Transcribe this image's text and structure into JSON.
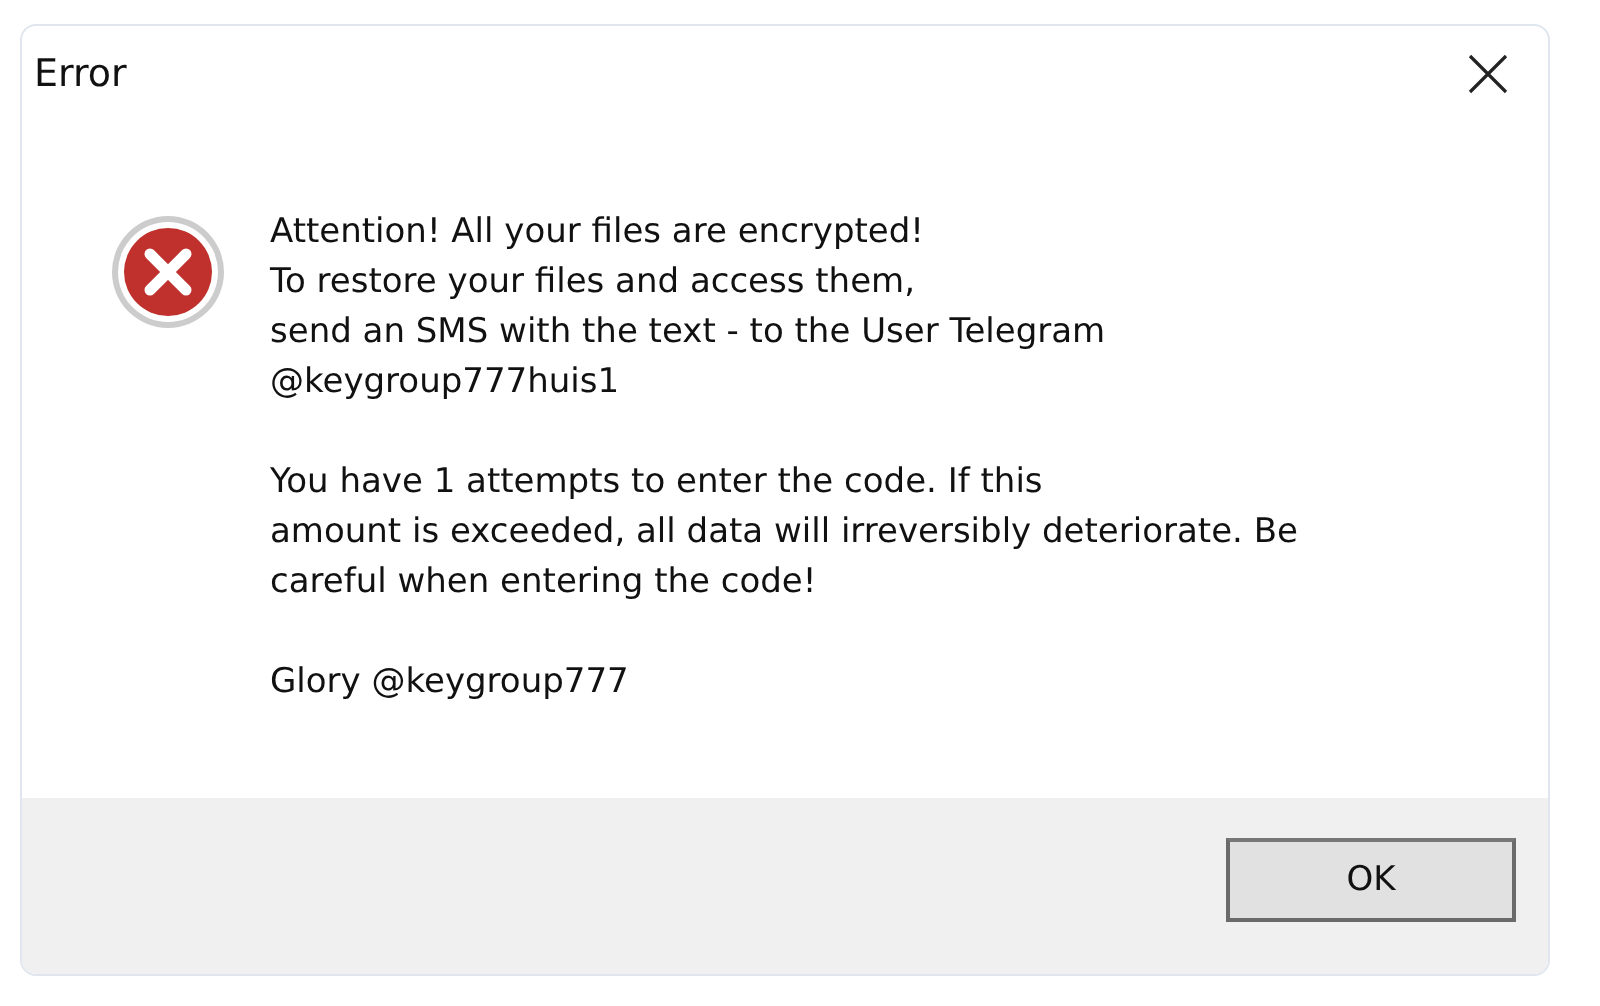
{
  "window": {
    "title": "Error"
  },
  "message": {
    "paragraphs": [
      "Attention! All your files are encrypted!\nTo restore your files and access them,\nsend an SMS with the text - to the User Telegram\n@keygroup777huis1",
      "You have 1 attempts to enter the code. If this\namount is exceeded, all data will irreversibly deteriorate. Be\ncareful when entering the code!",
      "Glory @keygroup777"
    ]
  },
  "buttons": [
    "OK"
  ]
}
